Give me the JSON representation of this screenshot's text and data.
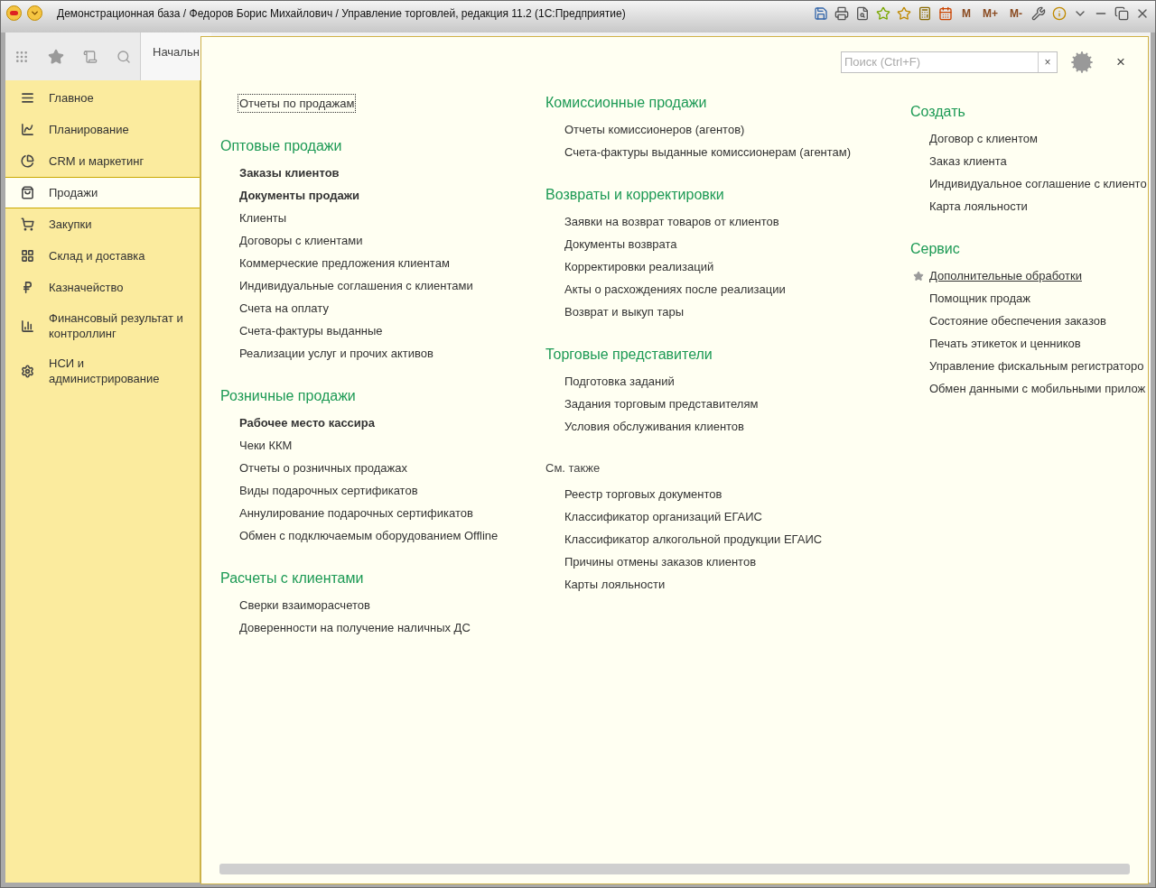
{
  "window": {
    "title": "Демонстрационная база / Федоров Борис Михайлович / Управление торговлей, редакция 11.2  (1С:Предприятие)",
    "memory_buttons": [
      "M",
      "M+",
      "M-"
    ]
  },
  "tabs": [
    {
      "label": "Начальн",
      "selected": true
    }
  ],
  "sidebar": {
    "items": [
      {
        "label": "Главное",
        "selected": false
      },
      {
        "label": "Планирование",
        "selected": false
      },
      {
        "label": "CRM и маркетинг",
        "selected": false
      },
      {
        "label": "Продажи",
        "selected": true
      },
      {
        "label": "Закупки",
        "selected": false
      },
      {
        "label": "Склад и доставка",
        "selected": false
      },
      {
        "label": "Казначейство",
        "selected": false
      },
      {
        "label": "Финансовый результат и контроллинг",
        "selected": false
      },
      {
        "label": "НСИ и администрирование",
        "selected": false
      }
    ]
  },
  "panel": {
    "search": {
      "placeholder": "Поиск (Ctrl+F)"
    },
    "clear_button": "×",
    "close_button": "×",
    "columns": [
      {
        "sections": [
          {
            "kind": "plain",
            "items": [
              {
                "label": "Отчеты по продажам",
                "bold": false,
                "focused": true,
                "favorite": false
              }
            ]
          },
          {
            "kind": "group",
            "heading": "Оптовые продажи",
            "items": [
              {
                "label": "Заказы клиентов",
                "bold": true,
                "focused": false,
                "favorite": false
              },
              {
                "label": "Документы продажи",
                "bold": true,
                "focused": false,
                "favorite": false
              },
              {
                "label": "Клиенты",
                "bold": false,
                "focused": false,
                "favorite": false
              },
              {
                "label": "Договоры с клиентами",
                "bold": false,
                "focused": false,
                "favorite": false
              },
              {
                "label": "Коммерческие предложения клиентам",
                "bold": false,
                "focused": false,
                "favorite": false
              },
              {
                "label": "Индивидуальные соглашения с клиентами",
                "bold": false,
                "focused": false,
                "favorite": false
              },
              {
                "label": "Счета на оплату",
                "bold": false,
                "focused": false,
                "favorite": false
              },
              {
                "label": "Счета-фактуры выданные",
                "bold": false,
                "focused": false,
                "favorite": false
              },
              {
                "label": "Реализации услуг и прочих активов",
                "bold": false,
                "focused": false,
                "favorite": false
              }
            ]
          },
          {
            "kind": "group",
            "heading": "Розничные продажи",
            "items": [
              {
                "label": "Рабочее место кассира",
                "bold": true,
                "focused": false,
                "favorite": false
              },
              {
                "label": "Чеки ККМ",
                "bold": false,
                "focused": false,
                "favorite": false
              },
              {
                "label": "Отчеты о розничных продажах",
                "bold": false,
                "focused": false,
                "favorite": false
              },
              {
                "label": "Виды подарочных сертификатов",
                "bold": false,
                "focused": false,
                "favorite": false
              },
              {
                "label": "Аннулирование подарочных сертификатов",
                "bold": false,
                "focused": false,
                "favorite": false
              },
              {
                "label": "Обмен с подключаемым оборудованием Offline",
                "bold": false,
                "focused": false,
                "favorite": false
              }
            ]
          },
          {
            "kind": "group",
            "heading": "Расчеты с клиентами",
            "items": [
              {
                "label": "Сверки взаиморасчетов",
                "bold": false,
                "focused": false,
                "favorite": false
              },
              {
                "label": "Доверенности на получение наличных ДС",
                "bold": false,
                "focused": false,
                "favorite": false
              }
            ]
          }
        ]
      },
      {
        "sections": [
          {
            "kind": "group",
            "heading": "Комиссионные продажи",
            "items": [
              {
                "label": "Отчеты комиссионеров (агентов)",
                "bold": false,
                "focused": false,
                "favorite": false
              },
              {
                "label": "Счета-фактуры выданные комиссионерам (агентам)",
                "bold": false,
                "focused": false,
                "favorite": false
              }
            ]
          },
          {
            "kind": "group",
            "heading": "Возвраты и корректировки",
            "items": [
              {
                "label": "Заявки на возврат товаров от клиентов",
                "bold": false,
                "focused": false,
                "favorite": false
              },
              {
                "label": "Документы возврата",
                "bold": false,
                "focused": false,
                "favorite": false
              },
              {
                "label": "Корректировки реализаций",
                "bold": false,
                "focused": false,
                "favorite": false
              },
              {
                "label": "Акты о расхождениях после реализации",
                "bold": false,
                "focused": false,
                "favorite": false
              },
              {
                "label": "Возврат и выкуп тары",
                "bold": false,
                "focused": false,
                "favorite": false
              }
            ]
          },
          {
            "kind": "group",
            "heading": "Торговые представители",
            "items": [
              {
                "label": "Подготовка заданий",
                "bold": false,
                "focused": false,
                "favorite": false
              },
              {
                "label": "Задания торговым представителям",
                "bold": false,
                "focused": false,
                "favorite": false
              },
              {
                "label": "Условия обслуживания клиентов",
                "bold": false,
                "focused": false,
                "favorite": false
              }
            ]
          },
          {
            "kind": "see_also",
            "heading": "См. также",
            "items": [
              {
                "label": "Реестр торговых документов",
                "bold": false,
                "focused": false,
                "favorite": false
              },
              {
                "label": "Классификатор организаций ЕГАИС",
                "bold": false,
                "focused": false,
                "favorite": false
              },
              {
                "label": "Классификатор алкогольной продукции ЕГАИС",
                "bold": false,
                "focused": false,
                "favorite": false
              },
              {
                "label": "Причины отмены заказов клиентов",
                "bold": false,
                "focused": false,
                "favorite": false
              },
              {
                "label": "Карты лояльности",
                "bold": false,
                "focused": false,
                "favorite": false
              }
            ]
          }
        ]
      },
      {
        "sections": [
          {
            "kind": "group",
            "heading": "Создать",
            "items": [
              {
                "label": "Договор с клиентом",
                "bold": false,
                "focused": false,
                "favorite": false
              },
              {
                "label": "Заказ клиента",
                "bold": false,
                "focused": false,
                "favorite": false
              },
              {
                "label": "Индивидуальное соглашение с клиенто",
                "bold": false,
                "focused": false,
                "favorite": false
              },
              {
                "label": "Карта лояльности",
                "bold": false,
                "focused": false,
                "favorite": false
              }
            ]
          },
          {
            "kind": "group",
            "heading": "Сервис",
            "items": [
              {
                "label": "Дополнительные обработки",
                "bold": false,
                "focused": false,
                "favorite": true
              },
              {
                "label": "Помощник продаж",
                "bold": false,
                "focused": false,
                "favorite": false
              },
              {
                "label": "Состояние обеспечения заказов",
                "bold": false,
                "focused": false,
                "favorite": false
              },
              {
                "label": "Печать этикеток и ценников",
                "bold": false,
                "focused": false,
                "favorite": false
              },
              {
                "label": "Управление фискальным регистраторо",
                "bold": false,
                "focused": false,
                "favorite": false
              },
              {
                "label": "Обмен данными с мобильными прилож",
                "bold": false,
                "focused": false,
                "favorite": false
              }
            ]
          }
        ]
      }
    ]
  }
}
